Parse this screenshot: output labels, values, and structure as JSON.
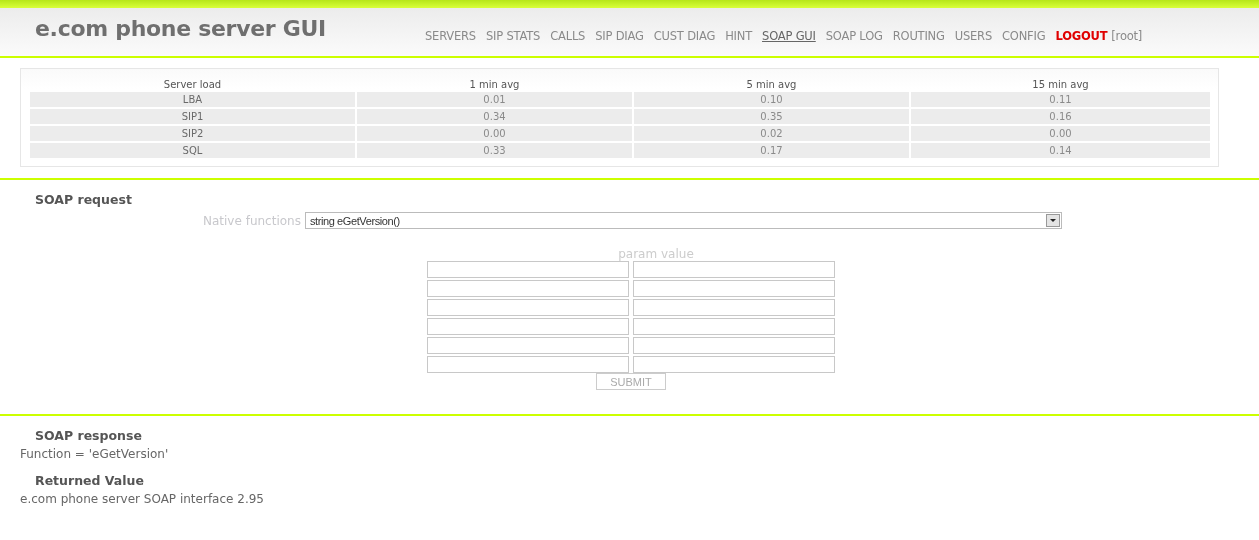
{
  "header": {
    "title": "e.com phone server GUI"
  },
  "nav": [
    {
      "label": "SERVERS",
      "selected": false,
      "kind": "link"
    },
    {
      "label": "SIP STATS",
      "selected": false,
      "kind": "link"
    },
    {
      "label": "CALLS",
      "selected": false,
      "kind": "link"
    },
    {
      "label": "SIP DIAG",
      "selected": false,
      "kind": "link"
    },
    {
      "label": "CUST DIAG",
      "selected": false,
      "kind": "link"
    },
    {
      "label": "HINT",
      "selected": false,
      "kind": "link"
    },
    {
      "label": "SOAP GUI",
      "selected": true,
      "kind": "link"
    },
    {
      "label": "SOAP LOG",
      "selected": false,
      "kind": "link"
    },
    {
      "label": "ROUTING",
      "selected": false,
      "kind": "link"
    },
    {
      "label": "USERS",
      "selected": false,
      "kind": "link"
    },
    {
      "label": "CONFIG",
      "selected": false,
      "kind": "link"
    },
    {
      "label": "LOGOUT",
      "selected": false,
      "kind": "logout"
    }
  ],
  "user": "[root]",
  "load_table": {
    "columns": [
      "Server load",
      "1 min avg",
      "5 min avg",
      "15 min avg"
    ],
    "rows": [
      [
        "LBA",
        "0.01",
        "0.10",
        "0.11"
      ],
      [
        "SIP1",
        "0.34",
        "0.35",
        "0.16"
      ],
      [
        "SIP2",
        "0.00",
        "0.02",
        "0.00"
      ],
      [
        "SQL",
        "0.33",
        "0.17",
        "0.14"
      ]
    ]
  },
  "soap_request": {
    "heading": "SOAP request",
    "function_label": "Native functions",
    "function_value": "string eGetVersion()",
    "params_heading": "param value",
    "submit": "SUBMIT"
  },
  "soap_response": {
    "heading": "SOAP response",
    "function_line": "Function = 'eGetVersion'",
    "returned_heading": "Returned Value",
    "returned_value": "e.com phone server SOAP interface 2.95"
  }
}
